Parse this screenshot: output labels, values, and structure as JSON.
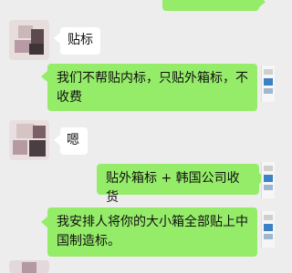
{
  "messages": [
    {
      "side": "right",
      "text": ""
    },
    {
      "side": "left",
      "text": "贴标"
    },
    {
      "side": "left",
      "text": "我们不帮贴内标，只贴外箱标，不收费"
    },
    {
      "side": "left",
      "text": "嗯"
    },
    {
      "side": "right",
      "text": "贴外箱标 + 韩国公司收货"
    },
    {
      "side": "left",
      "text": "我安排人将你的大小箱全部贴上中国制造标。"
    }
  ],
  "icons": {
    "contact_avatar": "blurred-avatar",
    "self_avatar": "document-thumbnail-avatar"
  },
  "colors": {
    "background": "#ededed",
    "sent_bubble": "#95ec69",
    "received_bubble": "#ffffff"
  }
}
